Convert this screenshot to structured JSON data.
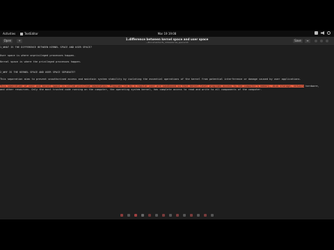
{
  "topbar": {
    "activities": "Activities",
    "app_name": "TextEditor",
    "clock": "Mar 19  19:08",
    "tray_icons": [
      "network-icon",
      "volume-icon",
      "power-icon"
    ]
  },
  "titlebar": {
    "open_label": "Open",
    "new_label": "+",
    "title": "1.difference between kernel space and user space",
    "subtitle": "~/Documents/cfs_notes/kernel_space.txt",
    "save_label": "Save",
    "menu_label": "≡"
  },
  "editor": {
    "lines": [
      "1_WHAT IS THE DIFFERENCE BETWEEN KERNEL SPACE AND USER SPACE?",
      "",
      "User space is where unprivileged processes happen.",
      "",
      "Kernel space is where the privileged processes happen.",
      "",
      "",
      "2_WHY IS THE KERNEL SPACE AND USER SPACE SEPARATE?",
      "",
      "This separation aims to prevent unauthorised access and maintain system stability by isolating the essential operations of the kernel from potential interference or damage caused by user applications."
    ],
    "highlight_text": "This separation of user and kernel space is called privilege separation. Programs run by a regular user are sandboxed so that kernel-level programs access to the computer's memory, disk storage, network",
    "tail_1": " hardware,",
    "line_after": "and other resources. Only the most trusted code running on the computer, the operating system kernel, has complete access to read and write to all components of the computer."
  },
  "colors": {
    "highlight": "#e25c3f",
    "background": "#1e1e1e"
  }
}
